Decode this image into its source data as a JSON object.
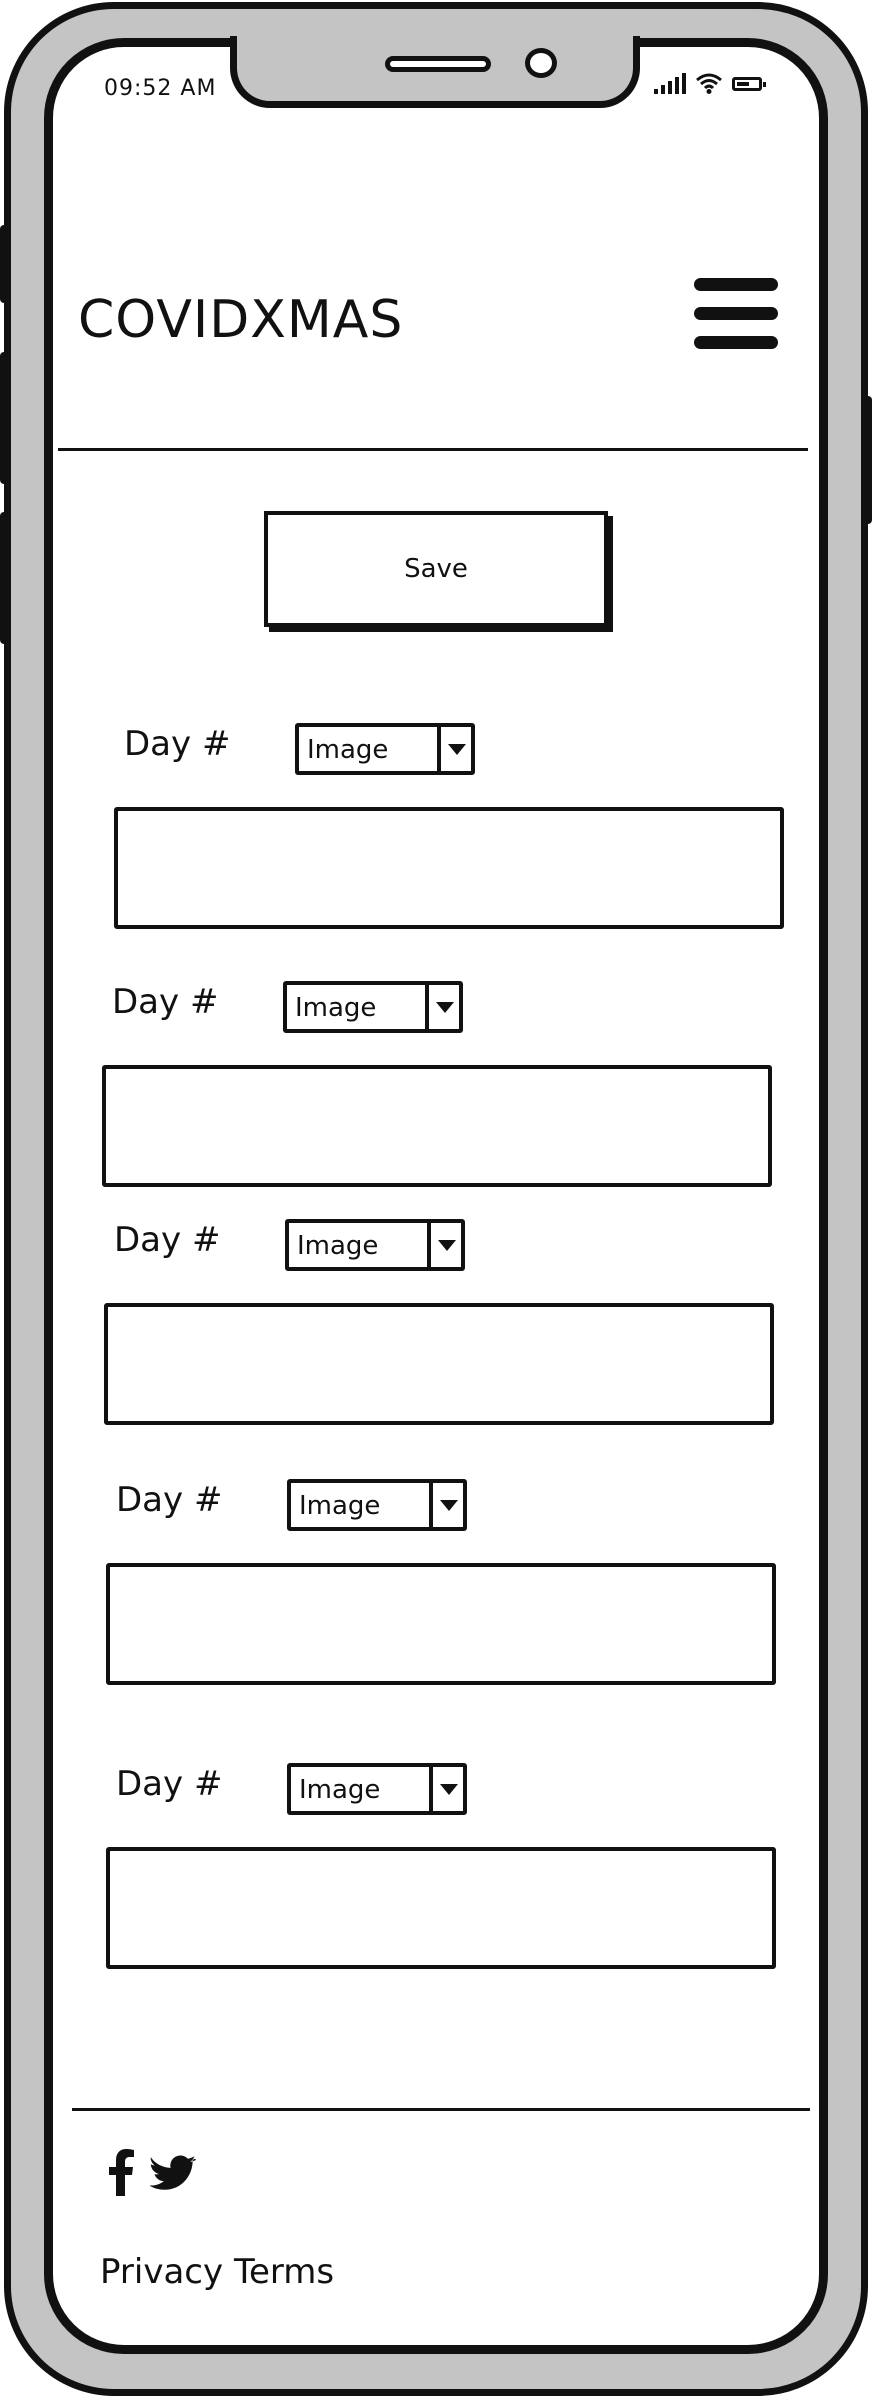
{
  "status_bar": {
    "time": "09:52 AM",
    "icons": [
      "signal-icon",
      "wifi-icon",
      "battery-icon"
    ]
  },
  "header": {
    "brand": "COVIDXMAS",
    "menu_icon": "hamburger-menu-icon"
  },
  "toolbar": {
    "save_label": "Save"
  },
  "days": [
    {
      "label": "Day #",
      "select_value": "Image",
      "content": ""
    },
    {
      "label": "Day #",
      "select_value": "Image",
      "content": ""
    },
    {
      "label": "Day #",
      "select_value": "Image",
      "content": ""
    },
    {
      "label": "Day #",
      "select_value": "Image",
      "content": ""
    },
    {
      "label": "Day #",
      "select_value": "Image",
      "content": ""
    }
  ],
  "footer": {
    "social_icons": [
      "facebook-icon",
      "twitter-icon"
    ],
    "links": [
      "Privacy",
      "Terms"
    ]
  },
  "colors": {
    "frame": "#c4c4c4",
    "ink": "#111111",
    "screen": "#ffffff"
  }
}
